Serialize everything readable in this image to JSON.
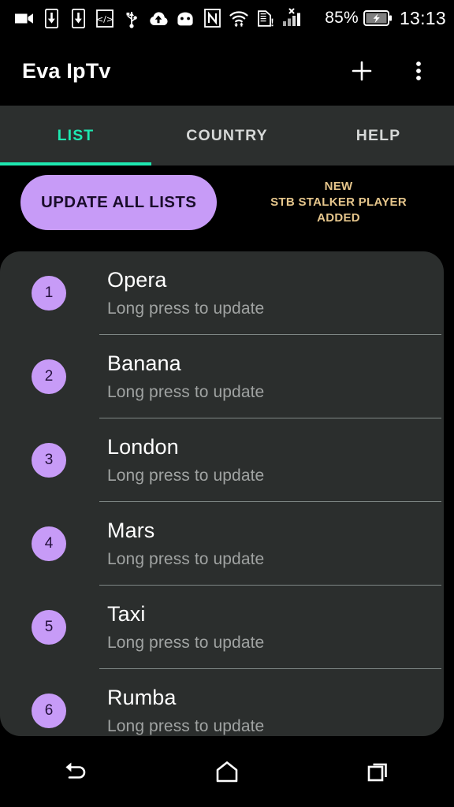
{
  "status_bar": {
    "icons": [
      "video-camera-icon",
      "phone-download-icon",
      "phone-download-alt-icon",
      "developer-code-icon",
      "usb-icon",
      "cloud-upload-icon",
      "android-head-icon",
      "nfc-icon",
      "wifi-transfer-icon",
      "sim-card-alert-icon",
      "signal-no-service-icon"
    ],
    "battery_percent": "85%",
    "battery_state_icon": "battery-charging-icon",
    "clock": "13:13"
  },
  "app_bar": {
    "title": "Eva IpTv",
    "add_icon": "plus-icon",
    "overflow_icon": "more-vertical-icon"
  },
  "tabs": {
    "active_index": 0,
    "accent_color": "#1EE8B0",
    "items": [
      {
        "label": "LIST"
      },
      {
        "label": "COUNTRY"
      },
      {
        "label": "HELP"
      }
    ]
  },
  "action_row": {
    "update_all_label": "UPDATE ALL LISTS",
    "update_all_color": "#C79BF7",
    "promo": {
      "line1": "NEW",
      "line2": "STB STALKER PLAYER",
      "line3": "ADDED",
      "color": "#E6C68C"
    }
  },
  "playlists": {
    "subtitle_text": "Long press to update",
    "badge_color": "#C79BF7",
    "items": [
      {
        "number": "1",
        "name": "Opera",
        "subtitle": "Long press to update"
      },
      {
        "number": "2",
        "name": "Banana",
        "subtitle": "Long press to update"
      },
      {
        "number": "3",
        "name": "London",
        "subtitle": "Long press to update"
      },
      {
        "number": "4",
        "name": "Mars",
        "subtitle": "Long press to update"
      },
      {
        "number": "5",
        "name": "Taxi",
        "subtitle": "Long press to update"
      },
      {
        "number": "6",
        "name": "Rumba",
        "subtitle": "Long press to update"
      }
    ]
  },
  "nav_bar": {
    "back_icon": "back-arrow-icon",
    "home_icon": "home-icon",
    "recents_icon": "recents-icon"
  }
}
